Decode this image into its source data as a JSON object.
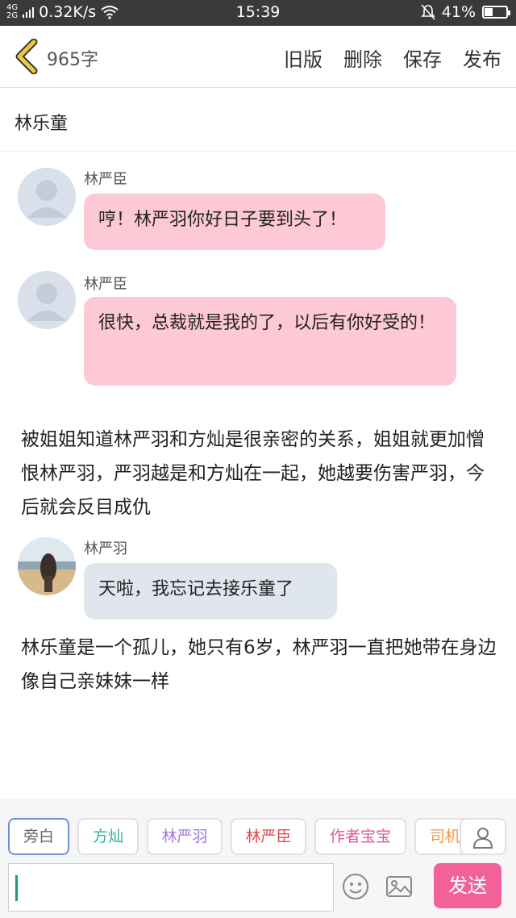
{
  "status_bar": {
    "network_top": "4G",
    "network_bottom": "2G",
    "speed": "0.32K/s",
    "time": "15:39",
    "battery_text": "41%",
    "battery_level": 0.41
  },
  "header": {
    "word_count": "965字",
    "actions": [
      "旧版",
      "删除",
      "保存",
      "发布"
    ]
  },
  "story_title": "林乐童",
  "messages": [
    {
      "sender": "林严臣",
      "text": "哼！林严羽你好日子要到头了！",
      "style": "pink",
      "avatar": "default"
    },
    {
      "sender": "林严臣",
      "text": "很快，总裁就是我的了，以后有你好受的！",
      "style": "pink",
      "avatar": "default"
    }
  ],
  "narration_1": "被姐姐知道林严羽和方灿是很亲密的关系，姐姐就更加憎恨林严羽，严羽越是和方灿在一起，她越要伤害严羽，今后就会反目成仇",
  "message_3": {
    "sender": "林严羽",
    "text": "天啦，我忘记去接乐童了",
    "style": "blue",
    "avatar": "photo"
  },
  "narration_2": "林乐童是一个孤儿，她只有6岁，林严羽一直把她带在身边像自己亲妹妹一样",
  "roles": [
    {
      "label": "旁白",
      "color": "#666666",
      "active": true
    },
    {
      "label": "方灿",
      "color": "#2bb3a0",
      "active": false
    },
    {
      "label": "林严羽",
      "color": "#a77ad8",
      "active": false
    },
    {
      "label": "林严臣",
      "color": "#e0494f",
      "active": false
    },
    {
      "label": "作者宝宝",
      "color": "#e0569a",
      "active": false
    },
    {
      "label": "司机",
      "color": "#f09a4a",
      "active": false
    }
  ],
  "input": {
    "value": "",
    "send_label": "发送"
  },
  "colors": {
    "pink_bubble": "#fdc9d6",
    "blue_bubble": "#dfe6ee",
    "send_button": "#f2619a",
    "back_chevron": "#f0c93a"
  }
}
